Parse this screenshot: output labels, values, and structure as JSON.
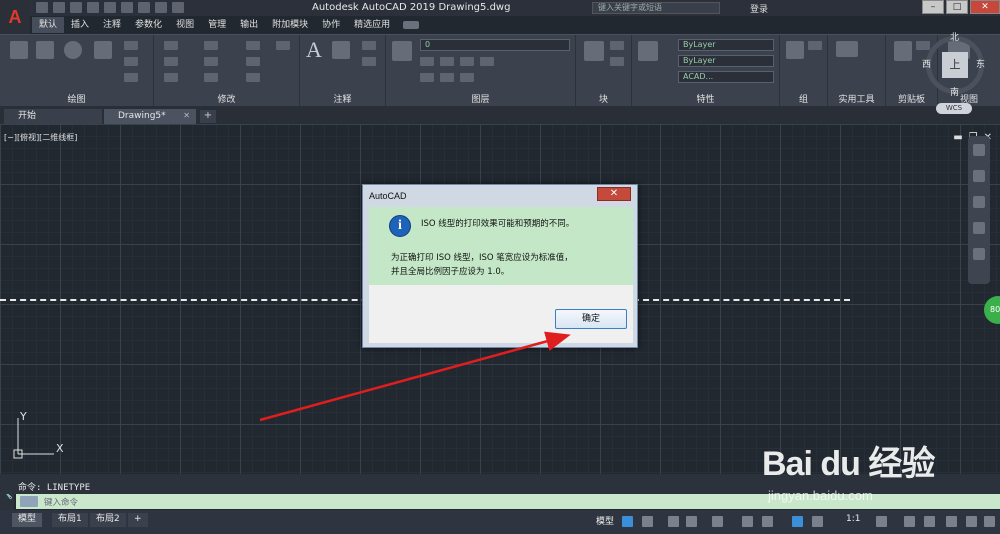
{
  "app": {
    "logo": "A",
    "title": "Autodesk AutoCAD 2019     Drawing5.dwg",
    "search_placeholder": "键入关键字或短语",
    "login": "登录"
  },
  "ribbon_tabs": [
    "默认",
    "插入",
    "注释",
    "参数化",
    "视图",
    "管理",
    "输出",
    "附加模块",
    "协作",
    "精选应用"
  ],
  "ribbon_panels": {
    "draw": "绘图",
    "modify": "修改",
    "annotate": "注释",
    "layers": "图层",
    "block": "块",
    "properties": "特性",
    "groups": "组",
    "utilities": "实用工具",
    "clipboard": "剪贴板",
    "view": "视图",
    "layer_value": "0",
    "bylayer": "ByLayer",
    "acad_linetype": "ACAD..."
  },
  "file_tabs": {
    "start": "开始",
    "drawing": "Drawing5*",
    "close": "✕",
    "plus": "+"
  },
  "canvas": {
    "viewport_label": "[−][俯视][二维线框]",
    "ucs_y": "Y",
    "ucs_x": "X"
  },
  "viewcube": {
    "north": "北",
    "south": "南",
    "east": "东",
    "west": "西",
    "face": "上",
    "wcs": "WCS"
  },
  "dialog": {
    "title": "AutoCAD",
    "close": "✕",
    "message1": "ISO 线型的打印效果可能和预期的不同。",
    "message2": "为正确打印 ISO 线型，ISO 笔宽应设为标准值，",
    "message3": "并且全局比例因子应设为 1.0。",
    "ok": "确定"
  },
  "command": {
    "history": "命令: LINETYPE",
    "placeholder": "键入命令"
  },
  "status": {
    "tabs": [
      "模型",
      "布局1",
      "布局2"
    ],
    "plus": "+",
    "model": "模型",
    "scale": "1:1"
  },
  "watermark": {
    "logo": "Bai du 经验",
    "url": "jingyan.baidu.com"
  },
  "badge": "80",
  "colors": {
    "accent_red": "#e03a2b",
    "dialog_body": "#c4e8c7",
    "arrow": "#e01e1e"
  }
}
